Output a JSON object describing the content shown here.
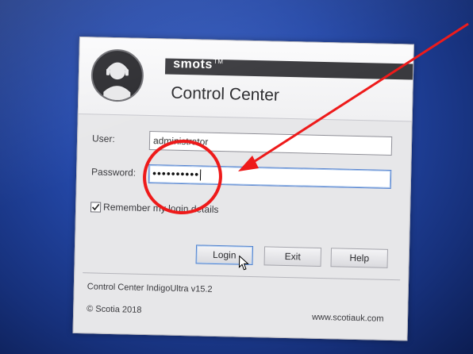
{
  "app": {
    "brand": "smots",
    "brand_tm": "TM",
    "title": "Control Center"
  },
  "form": {
    "user_label": "User:",
    "user_value": "administrator",
    "password_label": "Password:",
    "password_mask": "••••••••••",
    "remember_label": "Remember my login details",
    "remember_checked": true
  },
  "buttons": {
    "login": "Login",
    "exit": "Exit",
    "help": "Help"
  },
  "footer": {
    "version": "Control Center IndigoUltra v15.2",
    "copyright": "© Scotia 2018",
    "website": "www.scotiauk.com"
  },
  "colors": {
    "annotation": "#ee1a1a",
    "desktop": "#2448a8",
    "focus": "#4f82cf"
  },
  "icons": {
    "logo": "headset-person-logo",
    "checkbox": "check-icon",
    "cursor": "mouse-pointer-icon",
    "annotation": "red-arrow"
  }
}
